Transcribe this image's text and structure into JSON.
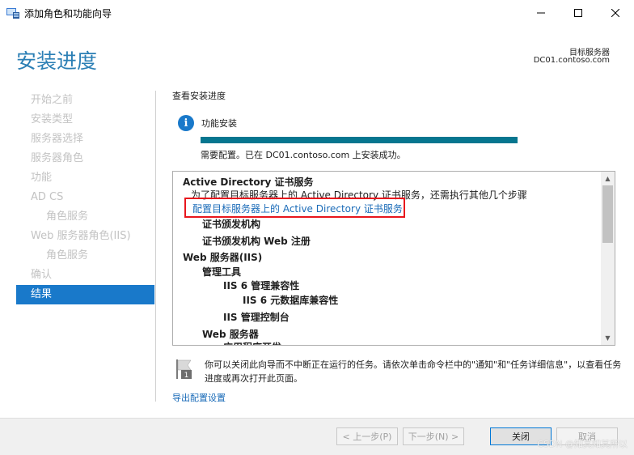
{
  "window": {
    "title": "添加角色和功能向导"
  },
  "header": {
    "page_title": "安装进度",
    "server_label": "目标服务器",
    "server_name": "DC01.contoso.com"
  },
  "sidebar": {
    "items": [
      {
        "label": "开始之前",
        "sub": false,
        "active": false
      },
      {
        "label": "安装类型",
        "sub": false,
        "active": false
      },
      {
        "label": "服务器选择",
        "sub": false,
        "active": false
      },
      {
        "label": "服务器角色",
        "sub": false,
        "active": false
      },
      {
        "label": "功能",
        "sub": false,
        "active": false
      },
      {
        "label": "AD CS",
        "sub": false,
        "active": false
      },
      {
        "label": "角色服务",
        "sub": true,
        "active": false
      },
      {
        "label": "Web 服务器角色(IIS)",
        "sub": false,
        "active": false
      },
      {
        "label": "角色服务",
        "sub": true,
        "active": false
      },
      {
        "label": "确认",
        "sub": false,
        "active": false
      },
      {
        "label": "结果",
        "sub": false,
        "active": true
      }
    ]
  },
  "main": {
    "section_label": "查看安装进度",
    "feature_label": "功能安装",
    "progress": 1.0,
    "status_text": "需要配置。已在 DC01.contoso.com 上安装成功。",
    "results": [
      {
        "text": "Active Directory 证书服务",
        "style": "bold"
      },
      {
        "text": "为了配置目标服务器上的 Active Directory 证书服务，还需执行其他几个步骤",
        "style": "normal"
      },
      {
        "text": "配置目标服务器上的 Active Directory 证书服务",
        "style": "link"
      },
      {
        "text": "证书颁发机构",
        "style": "bold"
      },
      {
        "text": "证书颁发机构 Web 注册",
        "style": "bold"
      },
      {
        "text": "Web 服务器(IIS)",
        "style": "bold"
      },
      {
        "text": "管理工具",
        "style": "bold"
      },
      {
        "text": "IIS 6 管理兼容性",
        "style": "bold"
      },
      {
        "text": "IIS 6 元数据库兼容性",
        "style": "bold"
      },
      {
        "text": "IIS 管理控制台",
        "style": "bold"
      },
      {
        "text": "Web 服务器",
        "style": "bold"
      },
      {
        "text": "应用程序开发",
        "style": "bold"
      }
    ],
    "footer_note": "你可以关闭此向导而不中断正在运行的任务。请依次单击命令栏中的\"通知\"和\"任务详细信息\"，以查看任务进度或再次打开此页面。",
    "flag_number": "1",
    "export_link": "导出配置设置"
  },
  "buttons": {
    "prev": "< 上一步(P)",
    "next": "下一步(N) >",
    "close": "关闭",
    "cancel": "取消"
  },
  "watermark": "CSDN @知其知其所以"
}
